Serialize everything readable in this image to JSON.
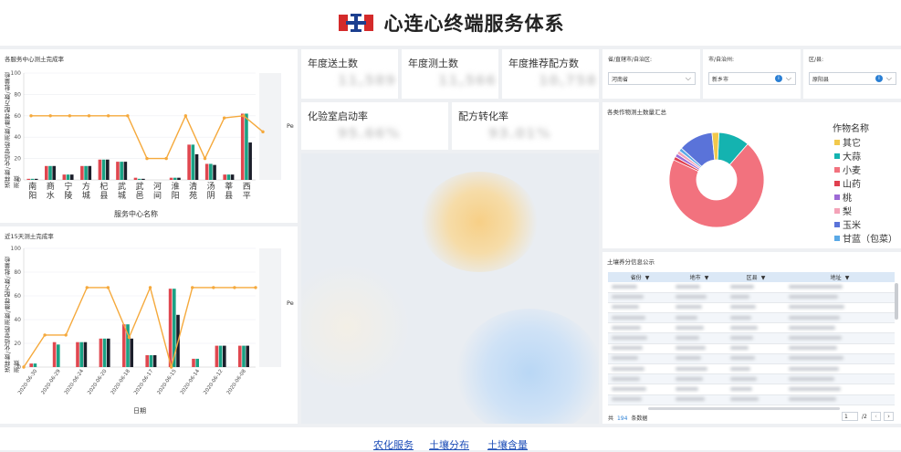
{
  "header": {
    "title": "心连心终端服务体系"
  },
  "chart1": {
    "title": "各服务中心测土完成率",
    "y_title": "送样数/化验室检测数/推荐配方数/批量检测数",
    "y2_title": "Pe",
    "y_ticks": [
      "100",
      "80",
      "60",
      "40",
      "20",
      "0"
    ],
    "x_title": "服务中心名称"
  },
  "chart2": {
    "title": "近15天测土完成率",
    "y_title": "送样数/化验室检测数/推荐配方数/批量检测数",
    "y2_title": "Pe",
    "y_ticks": [
      "100",
      "80",
      "60",
      "40",
      "20",
      "0"
    ],
    "x_title": "日期"
  },
  "chart_data": [
    {
      "type": "bar",
      "title": "各服务中心测土完成率",
      "xlabel": "服务中心名称",
      "ylabel": "送样数/化验室检测数/推荐配方数/批量检测数",
      "ylim": [
        0,
        100
      ],
      "categories": [
        "南阳",
        "商水",
        "宁陵",
        "方城",
        "杞县",
        "武城",
        "武邑",
        "河间",
        "淮阳",
        "清苑",
        "汤阴",
        "莘县",
        "西平"
      ],
      "series": [
        {
          "values": [
            1,
            13,
            5,
            13,
            19,
            17,
            2,
            0,
            2,
            33,
            15,
            5,
            62
          ]
        },
        {
          "values": [
            1,
            13,
            5,
            13,
            19,
            17,
            1,
            0,
            2,
            33,
            15,
            5,
            62
          ]
        },
        {
          "values": [
            1,
            13,
            5,
            13,
            19,
            17,
            1,
            0,
            2,
            24,
            14,
            5,
            35
          ]
        }
      ],
      "line": [
        60,
        60,
        60,
        60,
        60,
        60,
        20,
        20,
        60,
        20,
        58,
        60,
        45
      ]
    },
    {
      "type": "bar",
      "title": "近15天测土完成率",
      "xlabel": "日期",
      "ylabel": "送样数/化验室检测数/推荐配方数/批量检测数",
      "ylim": [
        0,
        100
      ],
      "categories": [
        "2020-06-30",
        "2020-06-29",
        "2020-06-24",
        "2020-06-20",
        "2020-06-18",
        "2020-06-17",
        "2020-06-15",
        "2020-06-14",
        "2020-06-12",
        "2020-06-08"
      ],
      "series": [
        {
          "values": [
            3,
            21,
            21,
            24,
            36,
            10,
            66,
            7,
            18,
            18
          ]
        },
        {
          "values": [
            3,
            19,
            21,
            24,
            36,
            10,
            66,
            7,
            18,
            18
          ]
        },
        {
          "values": [
            0,
            0,
            21,
            24,
            24,
            10,
            44,
            0,
            18,
            18
          ]
        }
      ],
      "line": [
        0,
        27,
        27,
        67,
        67,
        25,
        67,
        0,
        67,
        67,
        67,
        67
      ]
    },
    {
      "type": "pie",
      "title": "各类作物测土数量汇总",
      "legend_title": "作物名称",
      "labels": [
        "其它",
        "大蒜",
        "小麦",
        "山药",
        "桃",
        "梨",
        "玉米",
        "甘蓝（包菜）"
      ],
      "values": [
        2,
        9,
        60,
        1,
        1,
        1,
        10,
        1
      ]
    }
  ],
  "kpis": [
    {
      "label": "年度送土数",
      "value": "11,589"
    },
    {
      "label": "年度测土数",
      "value": "11,566"
    },
    {
      "label": "年度推荐配方数",
      "value": "10,758"
    },
    {
      "label": "化验室启动率",
      "value": "95.66%"
    },
    {
      "label": "配方转化率",
      "value": "93.01%"
    }
  ],
  "filters": [
    {
      "label": "省/直辖市/自治区:",
      "value": "河南省"
    },
    {
      "label": "市/自治州:",
      "value": "新乡市"
    },
    {
      "label": "区/县:",
      "value": "原阳县"
    }
  ],
  "pie": {
    "title": "各类作物测土数量汇总",
    "legend_title": "作物名称",
    "items": [
      {
        "name": "其它",
        "color": "#f2c94c"
      },
      {
        "name": "大蒜",
        "color": "#14b3b0"
      },
      {
        "name": "小麦",
        "color": "#f2727e"
      },
      {
        "name": "山药",
        "color": "#e0404f"
      },
      {
        "name": "桃",
        "color": "#9d6ad6"
      },
      {
        "name": "梨",
        "color": "#f4a3b8"
      },
      {
        "name": "玉米",
        "color": "#5a73d9"
      },
      {
        "name": "甘蓝（包菜）",
        "color": "#5aa9e6"
      }
    ]
  },
  "table": {
    "title": "土壤养分信息公示",
    "columns": [
      "省份",
      "地市",
      "区县",
      "地址"
    ],
    "count_prefix": "共",
    "count": "194",
    "count_suffix": "条数据",
    "page": "1",
    "page_total": "/2"
  },
  "footer": {
    "links": [
      "农化服务",
      "土壤分布",
      "土壤含量"
    ]
  }
}
